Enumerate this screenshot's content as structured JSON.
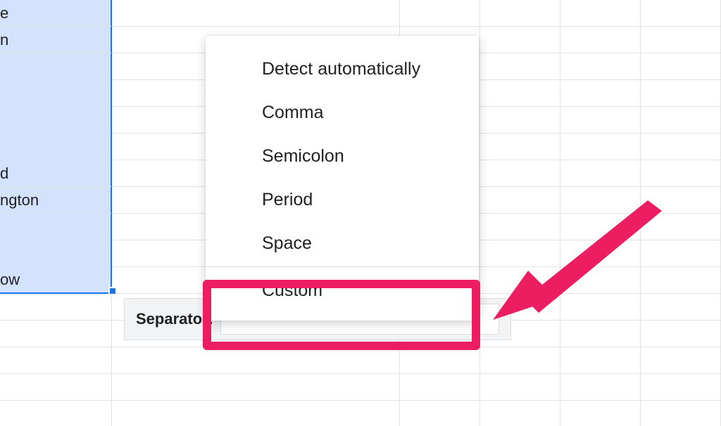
{
  "grid": {
    "cells": [
      "e",
      "n",
      "",
      "",
      "",
      "d",
      "ngton",
      "",
      "ow"
    ]
  },
  "separator": {
    "label": "Separator:"
  },
  "menu": {
    "items": [
      "Detect automatically",
      "Comma",
      "Semicolon",
      "Period",
      "Space"
    ],
    "custom": "Custom"
  },
  "colors": {
    "accent": "#1a73e8",
    "selection_fill": "#d3e3fd",
    "highlight": "#ec1e61"
  }
}
